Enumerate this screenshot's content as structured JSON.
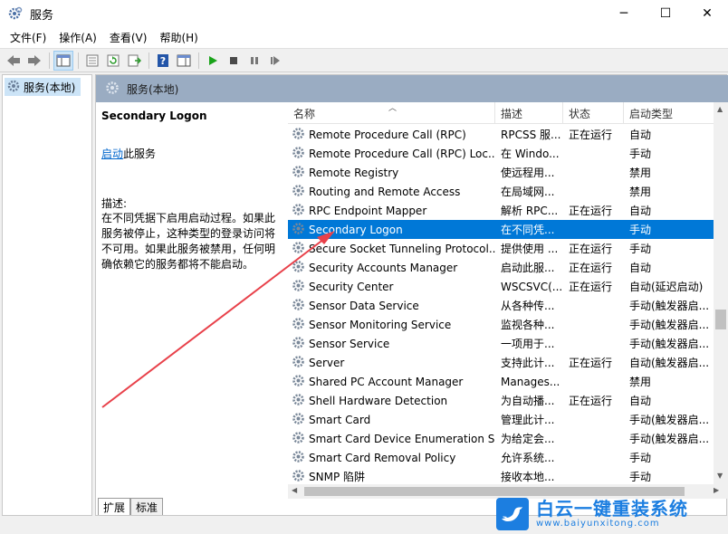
{
  "window": {
    "title": "服务",
    "min_glyph": "─",
    "max_glyph": "☐",
    "close_glyph": "✕"
  },
  "menu": [
    "文件(F)",
    "操作(A)",
    "查看(V)",
    "帮助(H)"
  ],
  "tree": {
    "item_label": "服务(本地)"
  },
  "main": {
    "header_title": "服务(本地)",
    "selected_service_name": "Secondary Logon",
    "start_link": "启动",
    "start_suffix": "此服务",
    "desc_label": "描述:",
    "desc_text": "在不同凭据下启用启动过程。如果此服务被停止，这种类型的登录访问将不可用。如果此服务被禁用，任何明确依赖它的服务都将不能启动。"
  },
  "columns": {
    "name": "名称",
    "desc": "描述",
    "status": "状态",
    "startup": "启动类型"
  },
  "services": [
    {
      "name": "Remote Procedure Call (RPC)",
      "desc": "RPCSS 服...",
      "status": "正在运行",
      "startup": "自动"
    },
    {
      "name": "Remote Procedure Call (RPC) Loc...",
      "desc": "在 Windo...",
      "status": "",
      "startup": "手动"
    },
    {
      "name": "Remote Registry",
      "desc": "使远程用...",
      "status": "",
      "startup": "禁用"
    },
    {
      "name": "Routing and Remote Access",
      "desc": "在局域网...",
      "status": "",
      "startup": "禁用"
    },
    {
      "name": "RPC Endpoint Mapper",
      "desc": "解析 RPC...",
      "status": "正在运行",
      "startup": "自动"
    },
    {
      "name": "Secondary Logon",
      "desc": "在不同凭...",
      "status": "",
      "startup": "手动",
      "selected": true
    },
    {
      "name": "Secure Socket Tunneling Protocol...",
      "desc": "提供使用 ...",
      "status": "正在运行",
      "startup": "手动"
    },
    {
      "name": "Security Accounts Manager",
      "desc": "启动此服...",
      "status": "正在运行",
      "startup": "自动"
    },
    {
      "name": "Security Center",
      "desc": "WSCSVC(...",
      "status": "正在运行",
      "startup": "自动(延迟启动)"
    },
    {
      "name": "Sensor Data Service",
      "desc": "从各种传...",
      "status": "",
      "startup": "手动(触发器启..."
    },
    {
      "name": "Sensor Monitoring Service",
      "desc": "监视各种...",
      "status": "",
      "startup": "手动(触发器启..."
    },
    {
      "name": "Sensor Service",
      "desc": "一项用于...",
      "status": "",
      "startup": "手动(触发器启..."
    },
    {
      "name": "Server",
      "desc": "支持此计...",
      "status": "正在运行",
      "startup": "自动(触发器启..."
    },
    {
      "name": "Shared PC Account Manager",
      "desc": "Manages...",
      "status": "",
      "startup": "禁用"
    },
    {
      "name": "Shell Hardware Detection",
      "desc": "为自动播...",
      "status": "正在运行",
      "startup": "自动"
    },
    {
      "name": "Smart Card",
      "desc": "管理此计...",
      "status": "",
      "startup": "手动(触发器启..."
    },
    {
      "name": "Smart Card Device Enumeration S...",
      "desc": "为给定会...",
      "status": "",
      "startup": "手动(触发器启..."
    },
    {
      "name": "Smart Card Removal Policy",
      "desc": "允许系统...",
      "status": "",
      "startup": "手动"
    },
    {
      "name": "SNMP 陷阱",
      "desc": "接收本地...",
      "status": "",
      "startup": "手动"
    }
  ],
  "tabs": [
    "扩展",
    "标准"
  ],
  "watermark": {
    "brand": "白云一键重装系统",
    "url": "www.baiyunxitong.com"
  },
  "colors": {
    "selection": "#0078d7",
    "header": "#9aacc2",
    "arrow": "#e8414a",
    "brand": "#1c7ee0"
  }
}
